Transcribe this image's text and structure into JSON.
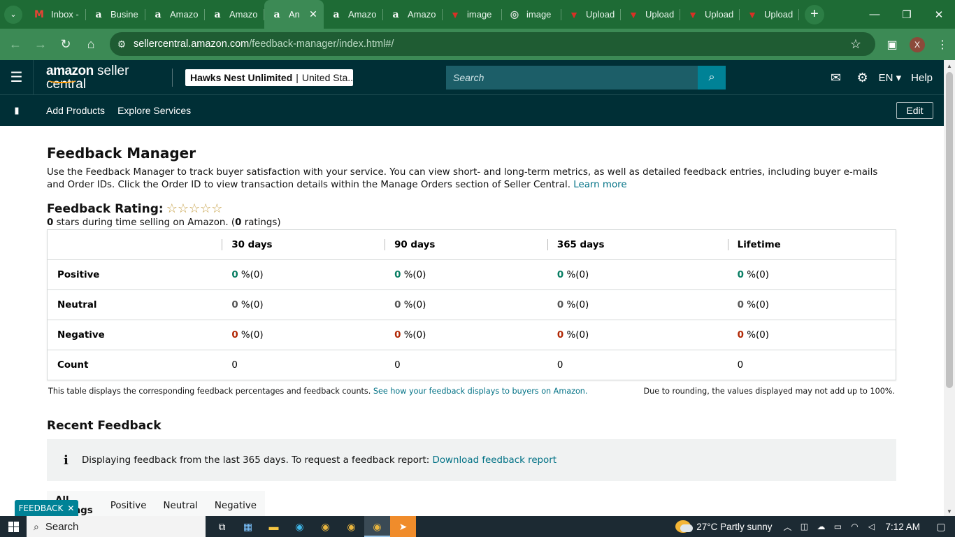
{
  "browser": {
    "tabs": [
      {
        "title": "Inbox -",
        "favicon": "gmail-icon"
      },
      {
        "title": "Busine",
        "favicon": "amazon-icon"
      },
      {
        "title": "Amazo",
        "favicon": "amazon-icon"
      },
      {
        "title": "Amazo",
        "favicon": "amazon-icon"
      },
      {
        "title": "An",
        "favicon": "amazon-icon",
        "active": true
      },
      {
        "title": "Amazo",
        "favicon": "amazon-icon"
      },
      {
        "title": "Amazo",
        "favicon": "amazon-icon"
      },
      {
        "title": "image",
        "favicon": "upload-icon"
      },
      {
        "title": "image",
        "favicon": "image-icon"
      },
      {
        "title": "Upload",
        "favicon": "upload-icon"
      },
      {
        "title": "Upload",
        "favicon": "upload-icon"
      },
      {
        "title": "Upload",
        "favicon": "upload-icon"
      },
      {
        "title": "Upload",
        "favicon": "upload-icon"
      }
    ],
    "url_host": "sellercentral.amazon.com",
    "url_path": "/feedback-manager/index.html#/",
    "profile_initial": "X",
    "accent_color": "#1e6b35"
  },
  "header": {
    "logo_brand": "amazon",
    "logo_product": "seller central",
    "store_name": "Hawks Nest Unlimited",
    "store_sep": "|",
    "store_region": "United Sta...",
    "search_placeholder": "Search",
    "language": "EN",
    "help": "Help",
    "bg_color": "#002f36"
  },
  "nav": {
    "links": [
      "Add Products",
      "Explore Services"
    ],
    "edit": "Edit"
  },
  "page": {
    "title": "Feedback Manager",
    "intro": "Use the Feedback Manager to track buyer satisfaction with your service. You can view short- and long-term metrics, as well as detailed feedback entries, including buyer e-mails and Order IDs. Click the Order ID to view transaction details within the Manage Orders section of Seller Central.",
    "learn_more": "Learn more",
    "rating_label": "Feedback Rating:",
    "stars_filled": 0,
    "stars_total": 5,
    "rating_sub_stars": "0",
    "rating_sub_mid": " stars during time selling on Amazon. (",
    "rating_sub_count": "0",
    "rating_sub_end": " ratings)"
  },
  "table": {
    "columns": [
      "30 days",
      "90 days",
      "365 days",
      "Lifetime"
    ],
    "rows": [
      {
        "label": "Positive",
        "cells": [
          {
            "value": "0",
            "suffix": " %(0)"
          },
          {
            "value": "0",
            "suffix": " %(0)"
          },
          {
            "value": "0",
            "suffix": " %(0)"
          },
          {
            "value": "0",
            "suffix": " %(0)"
          }
        ]
      },
      {
        "label": "Neutral",
        "cells": [
          {
            "value": "0",
            "suffix": " %(0)"
          },
          {
            "value": "0",
            "suffix": " %(0)"
          },
          {
            "value": "0",
            "suffix": " %(0)"
          },
          {
            "value": "0",
            "suffix": " %(0)"
          }
        ]
      },
      {
        "label": "Negative",
        "cells": [
          {
            "value": "0",
            "suffix": " %(0)"
          },
          {
            "value": "0",
            "suffix": " %(0)"
          },
          {
            "value": "0",
            "suffix": " %(0)"
          },
          {
            "value": "0",
            "suffix": " %(0)"
          }
        ]
      },
      {
        "label": "Count",
        "cells": [
          {
            "value": "0",
            "suffix": ""
          },
          {
            "value": "0",
            "suffix": ""
          },
          {
            "value": "0",
            "suffix": ""
          },
          {
            "value": "0",
            "suffix": ""
          }
        ]
      }
    ],
    "note_left": "This table displays the corresponding feedback percentages and feedback counts.",
    "note_link": "See how your feedback displays to buyers on Amazon.",
    "note_right": "Due to rounding, the values displayed may not add up to 100%.",
    "colors": {
      "positive": "#067d62",
      "neutral": "#555555",
      "negative": "#b12704"
    }
  },
  "recent": {
    "title": "Recent Feedback",
    "info_text": "Displaying feedback from the last 365 days. To request a feedback report:",
    "info_link": "Download feedback report",
    "filters": [
      "All ratings",
      "Positive",
      "Neutral",
      "Negative"
    ]
  },
  "feedback_tab": {
    "label": "FEEDBACK"
  },
  "taskbar": {
    "search": "Search",
    "weather": "27°C  Partly sunny",
    "time": "7:12 AM"
  }
}
